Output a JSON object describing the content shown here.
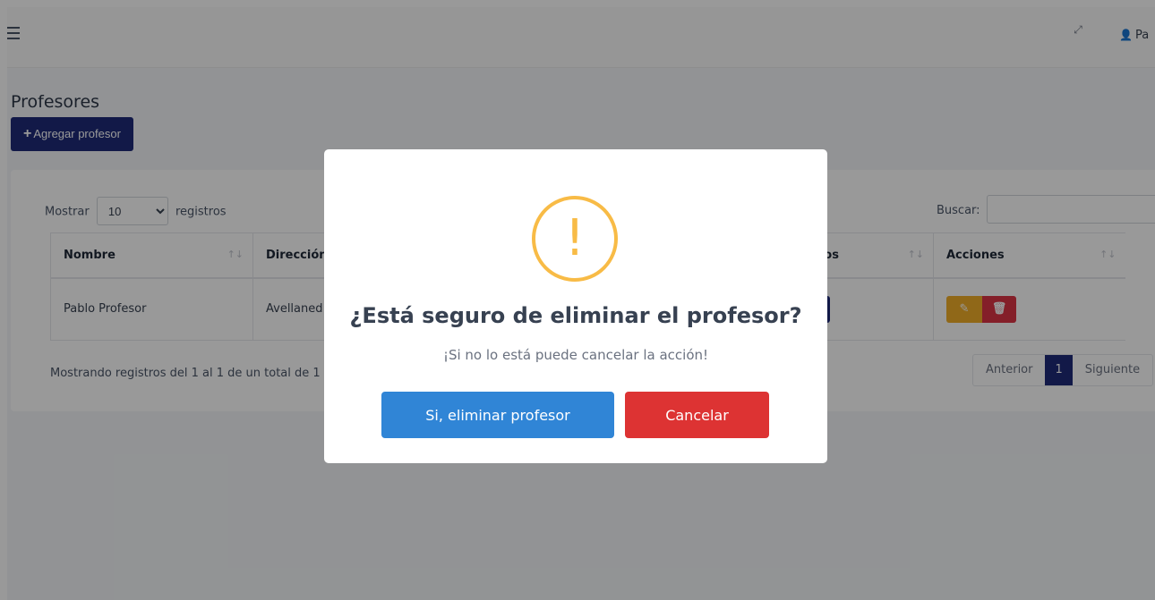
{
  "header": {
    "menu_icon": "hamburger-icon",
    "expand_icon": "expand-icon",
    "user_icon": "user-icon",
    "user_name": "Pa"
  },
  "page": {
    "title": "Profesores",
    "add_button_label": "Agregar profesor"
  },
  "table_controls": {
    "show_label": "Mostrar",
    "show_value": "10",
    "records_label": "registros",
    "search_label": "Buscar:",
    "search_value": ""
  },
  "table": {
    "columns": [
      "Nombre",
      "Dirección",
      "Pagos",
      "Acciones"
    ],
    "rows": [
      {
        "nombre": "Pablo Profesor",
        "direccion": "Avellaned",
        "pagos_symbol": "$"
      }
    ]
  },
  "footer": {
    "info": "Mostrando registros del 1 al 1 de un total de 1",
    "prev_label": "Anterior",
    "current_page": "1",
    "next_label": "Siguiente"
  },
  "modal": {
    "icon": "warning-icon",
    "icon_text": "!",
    "title": "¿Está seguro de eliminar el profesor?",
    "text": "¡Si no lo está puede cancelar la acción!",
    "confirm_label": "Si, eliminar profesor",
    "cancel_label": "Cancelar",
    "confirm_color": "#3085d6",
    "cancel_color": "#dd3333",
    "warning_color": "#f8bb46"
  }
}
